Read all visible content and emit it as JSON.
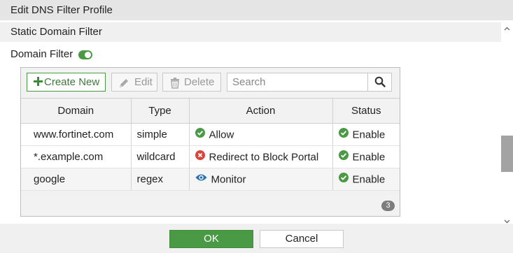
{
  "header": {
    "title": "Edit DNS Filter Profile"
  },
  "section": {
    "title": "Static Domain Filter"
  },
  "domain_filter": {
    "label": "Domain Filter",
    "enabled": true
  },
  "toolbar": {
    "create_label": "Create New",
    "edit_label": "Edit",
    "delete_label": "Delete",
    "search_placeholder": "Search"
  },
  "table": {
    "columns": [
      "Domain",
      "Type",
      "Action",
      "Status"
    ],
    "rows": [
      {
        "domain": "www.fortinet.com",
        "type": "simple",
        "action": "Allow",
        "action_icon": "check-circle-icon",
        "status": "Enable",
        "status_icon": "check-circle-icon"
      },
      {
        "domain": "*.example.com",
        "type": "wildcard",
        "action": "Redirect to Block Portal",
        "action_icon": "x-circle-icon",
        "status": "Enable",
        "status_icon": "check-circle-icon"
      },
      {
        "domain": "google",
        "type": "regex",
        "action": "Monitor",
        "action_icon": "eye-icon",
        "status": "Enable",
        "status_icon": "check-circle-icon"
      }
    ],
    "count": "3"
  },
  "footer": {
    "ok_label": "OK",
    "cancel_label": "Cancel"
  },
  "colors": {
    "accent_green": "#4a9a45",
    "deny_red": "#d9453b",
    "monitor_blue": "#2a6fb0"
  }
}
